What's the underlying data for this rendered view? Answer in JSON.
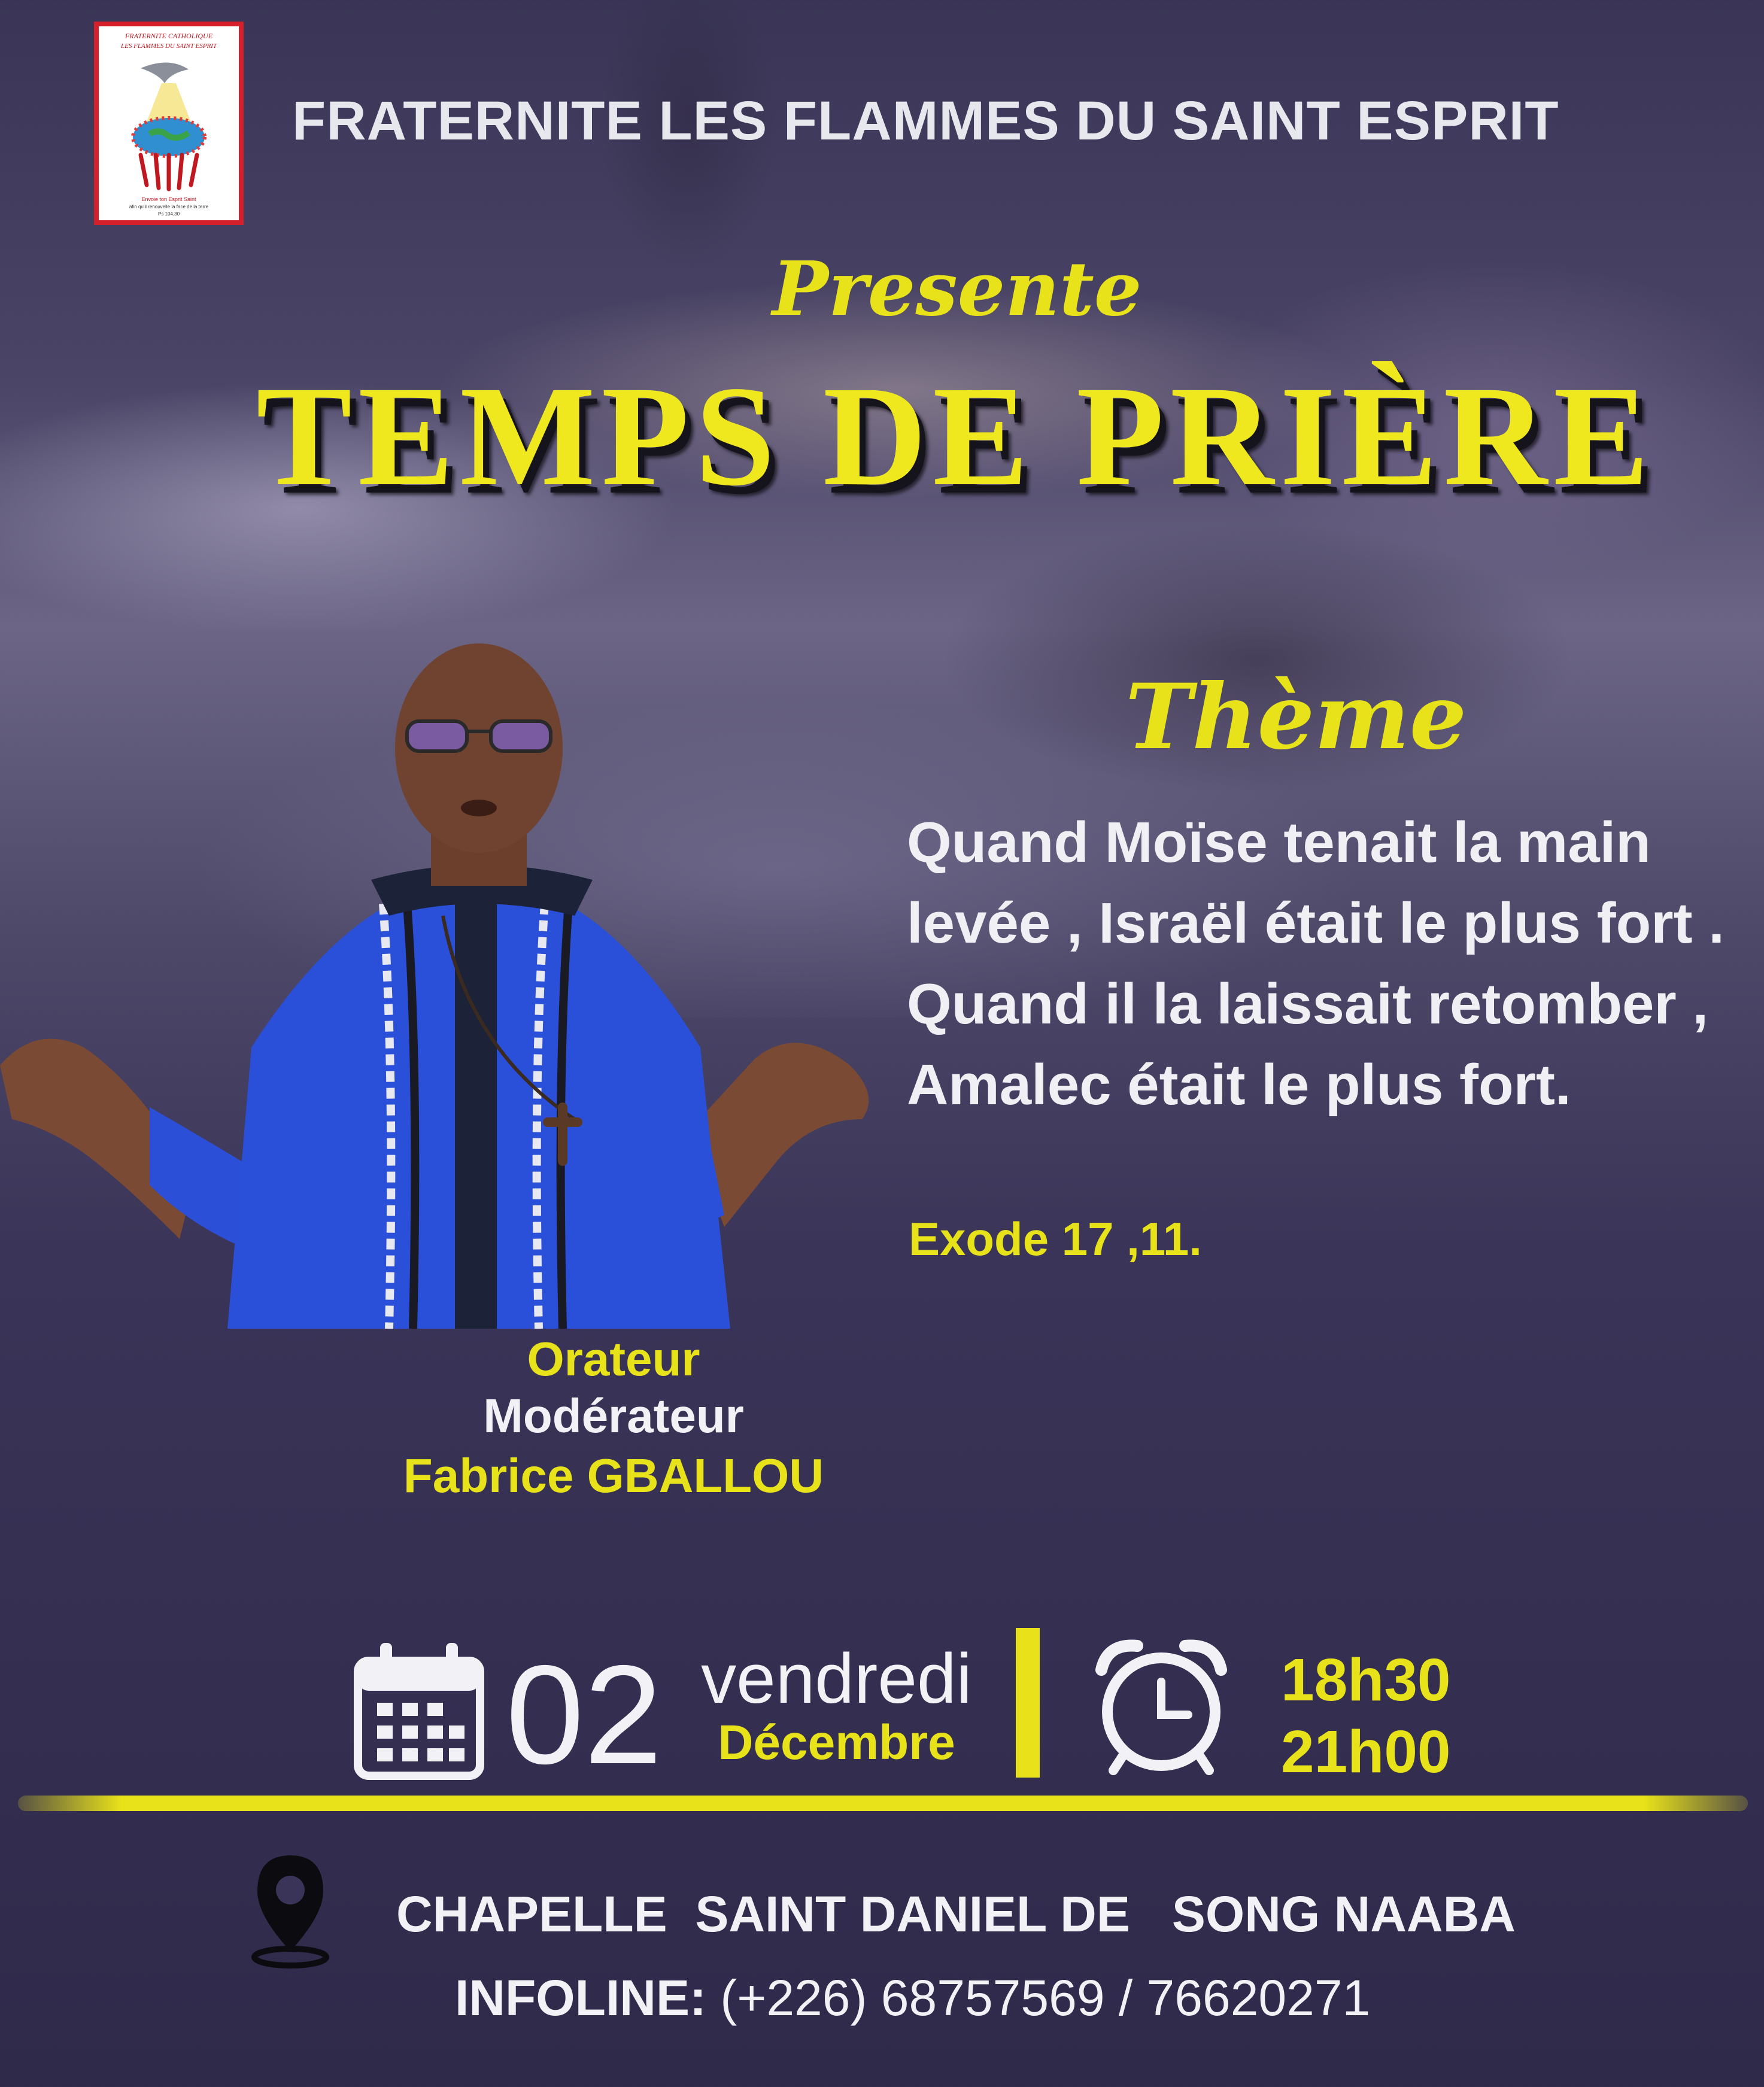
{
  "logo": {
    "line1": "FRATERNITE CATHOLIQUE",
    "line2": "LES FLAMMES DU SAINT ESPRIT",
    "caption1": "Envoie ton Esprit Saint",
    "caption2": "afin qu'il renouvelle la face de la terre",
    "caption3": "Ps 104,30"
  },
  "header": {
    "org_name": "FRATERNITE LES FLAMMES DU SAINT ESPRIT",
    "presente": "Presente",
    "title": "TEMPS DE PRIÈRE"
  },
  "theme": {
    "label": "Thème",
    "text": "Quand Moïse tenait la main levée , Israël était le plus fort . Quand il la laissait retomber , Amalec était le plus fort.",
    "reference": "Exode 17 ,11."
  },
  "speaker": {
    "role1": "Orateur",
    "role2": "Modérateur",
    "name": "Fabrice GBALLOU"
  },
  "schedule": {
    "day": "02",
    "weekday": "vendredi",
    "month": "Décembre",
    "time_start": "18h30",
    "time_end": "21h00"
  },
  "location": {
    "place": "CHAPELLE  SAINT DANIEL DE   SONG NAABA",
    "infoline_label": "INFOLINE:",
    "infoline_numbers": " (+226) 68757569 / 76620271"
  },
  "icons": [
    "calendar-icon",
    "clock-icon",
    "location-pin-icon"
  ],
  "colors": {
    "accent_yellow": "#e8e21a",
    "logo_red": "#d4202a",
    "background": "#3a3458"
  }
}
